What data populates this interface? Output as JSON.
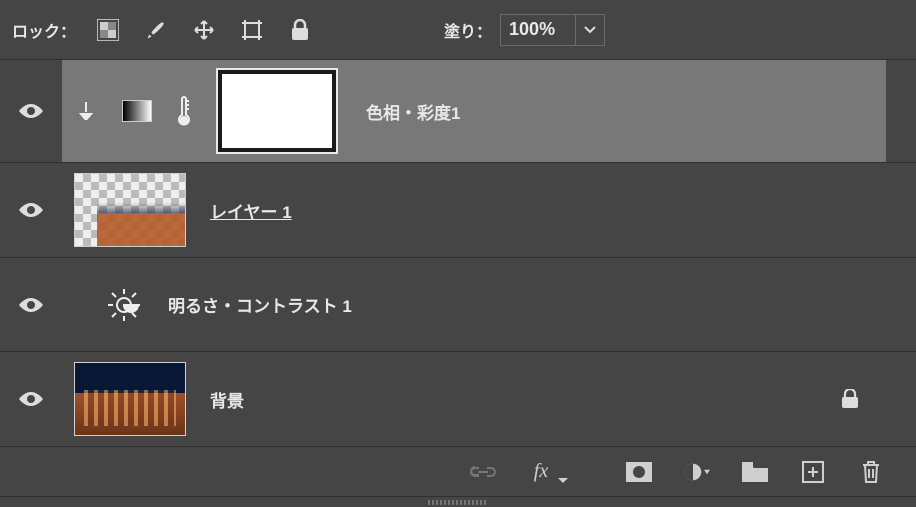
{
  "toolbar": {
    "lock_label": "ロック：",
    "icons": [
      "pixel-lock-icon",
      "brush-icon",
      "move-icon",
      "artboard-icon",
      "lock-all-icon"
    ],
    "fill_label": "塗り：",
    "fill_value": "100%"
  },
  "layers": [
    {
      "id": "hue-sat-1",
      "name": "色相・彩度1",
      "type": "adjustment-hue-sat",
      "clipped": true,
      "has_mask": true,
      "visible": true,
      "selected": true,
      "locked": false
    },
    {
      "id": "layer-1",
      "name": "レイヤー 1",
      "type": "pixel",
      "thumb": "building-transparent",
      "visible": true,
      "selected": false,
      "locked": false,
      "underline": true
    },
    {
      "id": "bright-contrast-1",
      "name": "明るさ・コントラスト 1",
      "type": "adjustment-brightness",
      "visible": true,
      "selected": false,
      "locked": false
    },
    {
      "id": "background",
      "name": "背景",
      "type": "pixel",
      "thumb": "building-night",
      "visible": true,
      "selected": false,
      "locked": true
    }
  ],
  "footer": {
    "icons": [
      "link-icon",
      "fx-icon",
      "mask-icon",
      "adjustment-icon",
      "group-icon",
      "new-layer-icon",
      "trash-icon"
    ]
  }
}
